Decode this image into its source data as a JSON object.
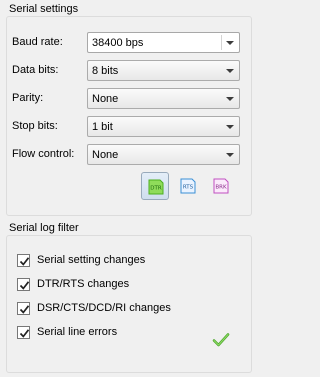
{
  "serial_settings": {
    "title": "Serial settings",
    "fields": [
      {
        "label": "Baud rate:",
        "value": "38400 bps",
        "editable": true
      },
      {
        "label": "Data bits:",
        "value": "8 bits"
      },
      {
        "label": "Parity:",
        "value": "None"
      },
      {
        "label": "Stop bits:",
        "value": "1 bit"
      },
      {
        "label": "Flow control:",
        "value": "None"
      }
    ],
    "signal_buttons": [
      {
        "label": "DTR",
        "color": "#4caf1f",
        "active": true
      },
      {
        "label": "RTS",
        "color": "#3a8fd6",
        "active": false
      },
      {
        "label": "BRK",
        "color": "#c04fc0",
        "active": false
      }
    ]
  },
  "serial_log_filter": {
    "title": "Serial log filter",
    "options": [
      {
        "label": "Serial setting changes",
        "checked": true
      },
      {
        "label": "DTR/RTS changes",
        "checked": true
      },
      {
        "label": "DSR/CTS/DCD/RI changes",
        "checked": true
      },
      {
        "label": "Serial line errors",
        "checked": true
      }
    ],
    "apply_icon": "green-checkmark-icon"
  }
}
